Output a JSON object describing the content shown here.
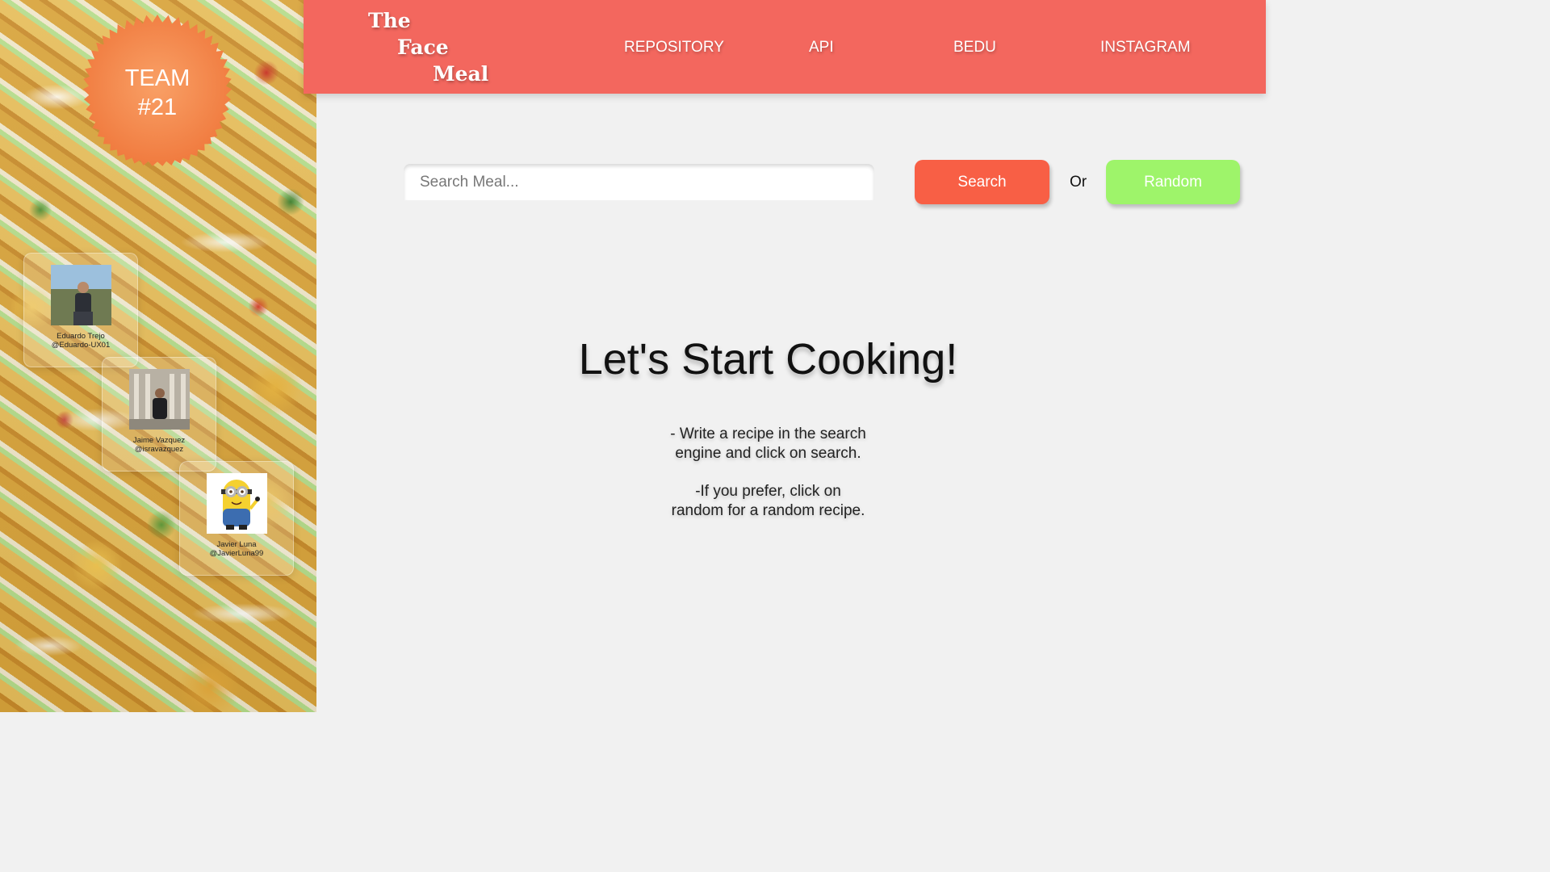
{
  "sidebar": {
    "team_badge": {
      "line1": "TEAM",
      "line2": "#21"
    },
    "members": [
      {
        "name": "Eduardo Trejo",
        "handle": "@Eduardo-UX01"
      },
      {
        "name": "Jaime Vazquez",
        "handle": "@isravazquez"
      },
      {
        "name": "Javier Luna",
        "handle": "@JavierLuna99"
      }
    ]
  },
  "header": {
    "logo": {
      "line1": "The",
      "line2": "Face",
      "line3": "Meal"
    },
    "nav": [
      "REPOSITORY",
      "API",
      "BEDU",
      "INSTAGRAM"
    ]
  },
  "search": {
    "placeholder": "Search Meal...",
    "value": "",
    "search_label": "Search",
    "or_label": "Or",
    "random_label": "Random"
  },
  "main": {
    "title": "Let's Start Cooking!",
    "hint1_line1": "- Write a recipe in the search",
    "hint1_line2": "engine and click on search.",
    "hint2_line1": "-If you prefer, click on",
    "hint2_line2": "random for a random recipe."
  },
  "colors": {
    "header": "#f3675e",
    "search_button": "#f85f45",
    "random_button": "#9ef46a",
    "badge": "#f07a3e",
    "background": "#f1f1f1"
  }
}
